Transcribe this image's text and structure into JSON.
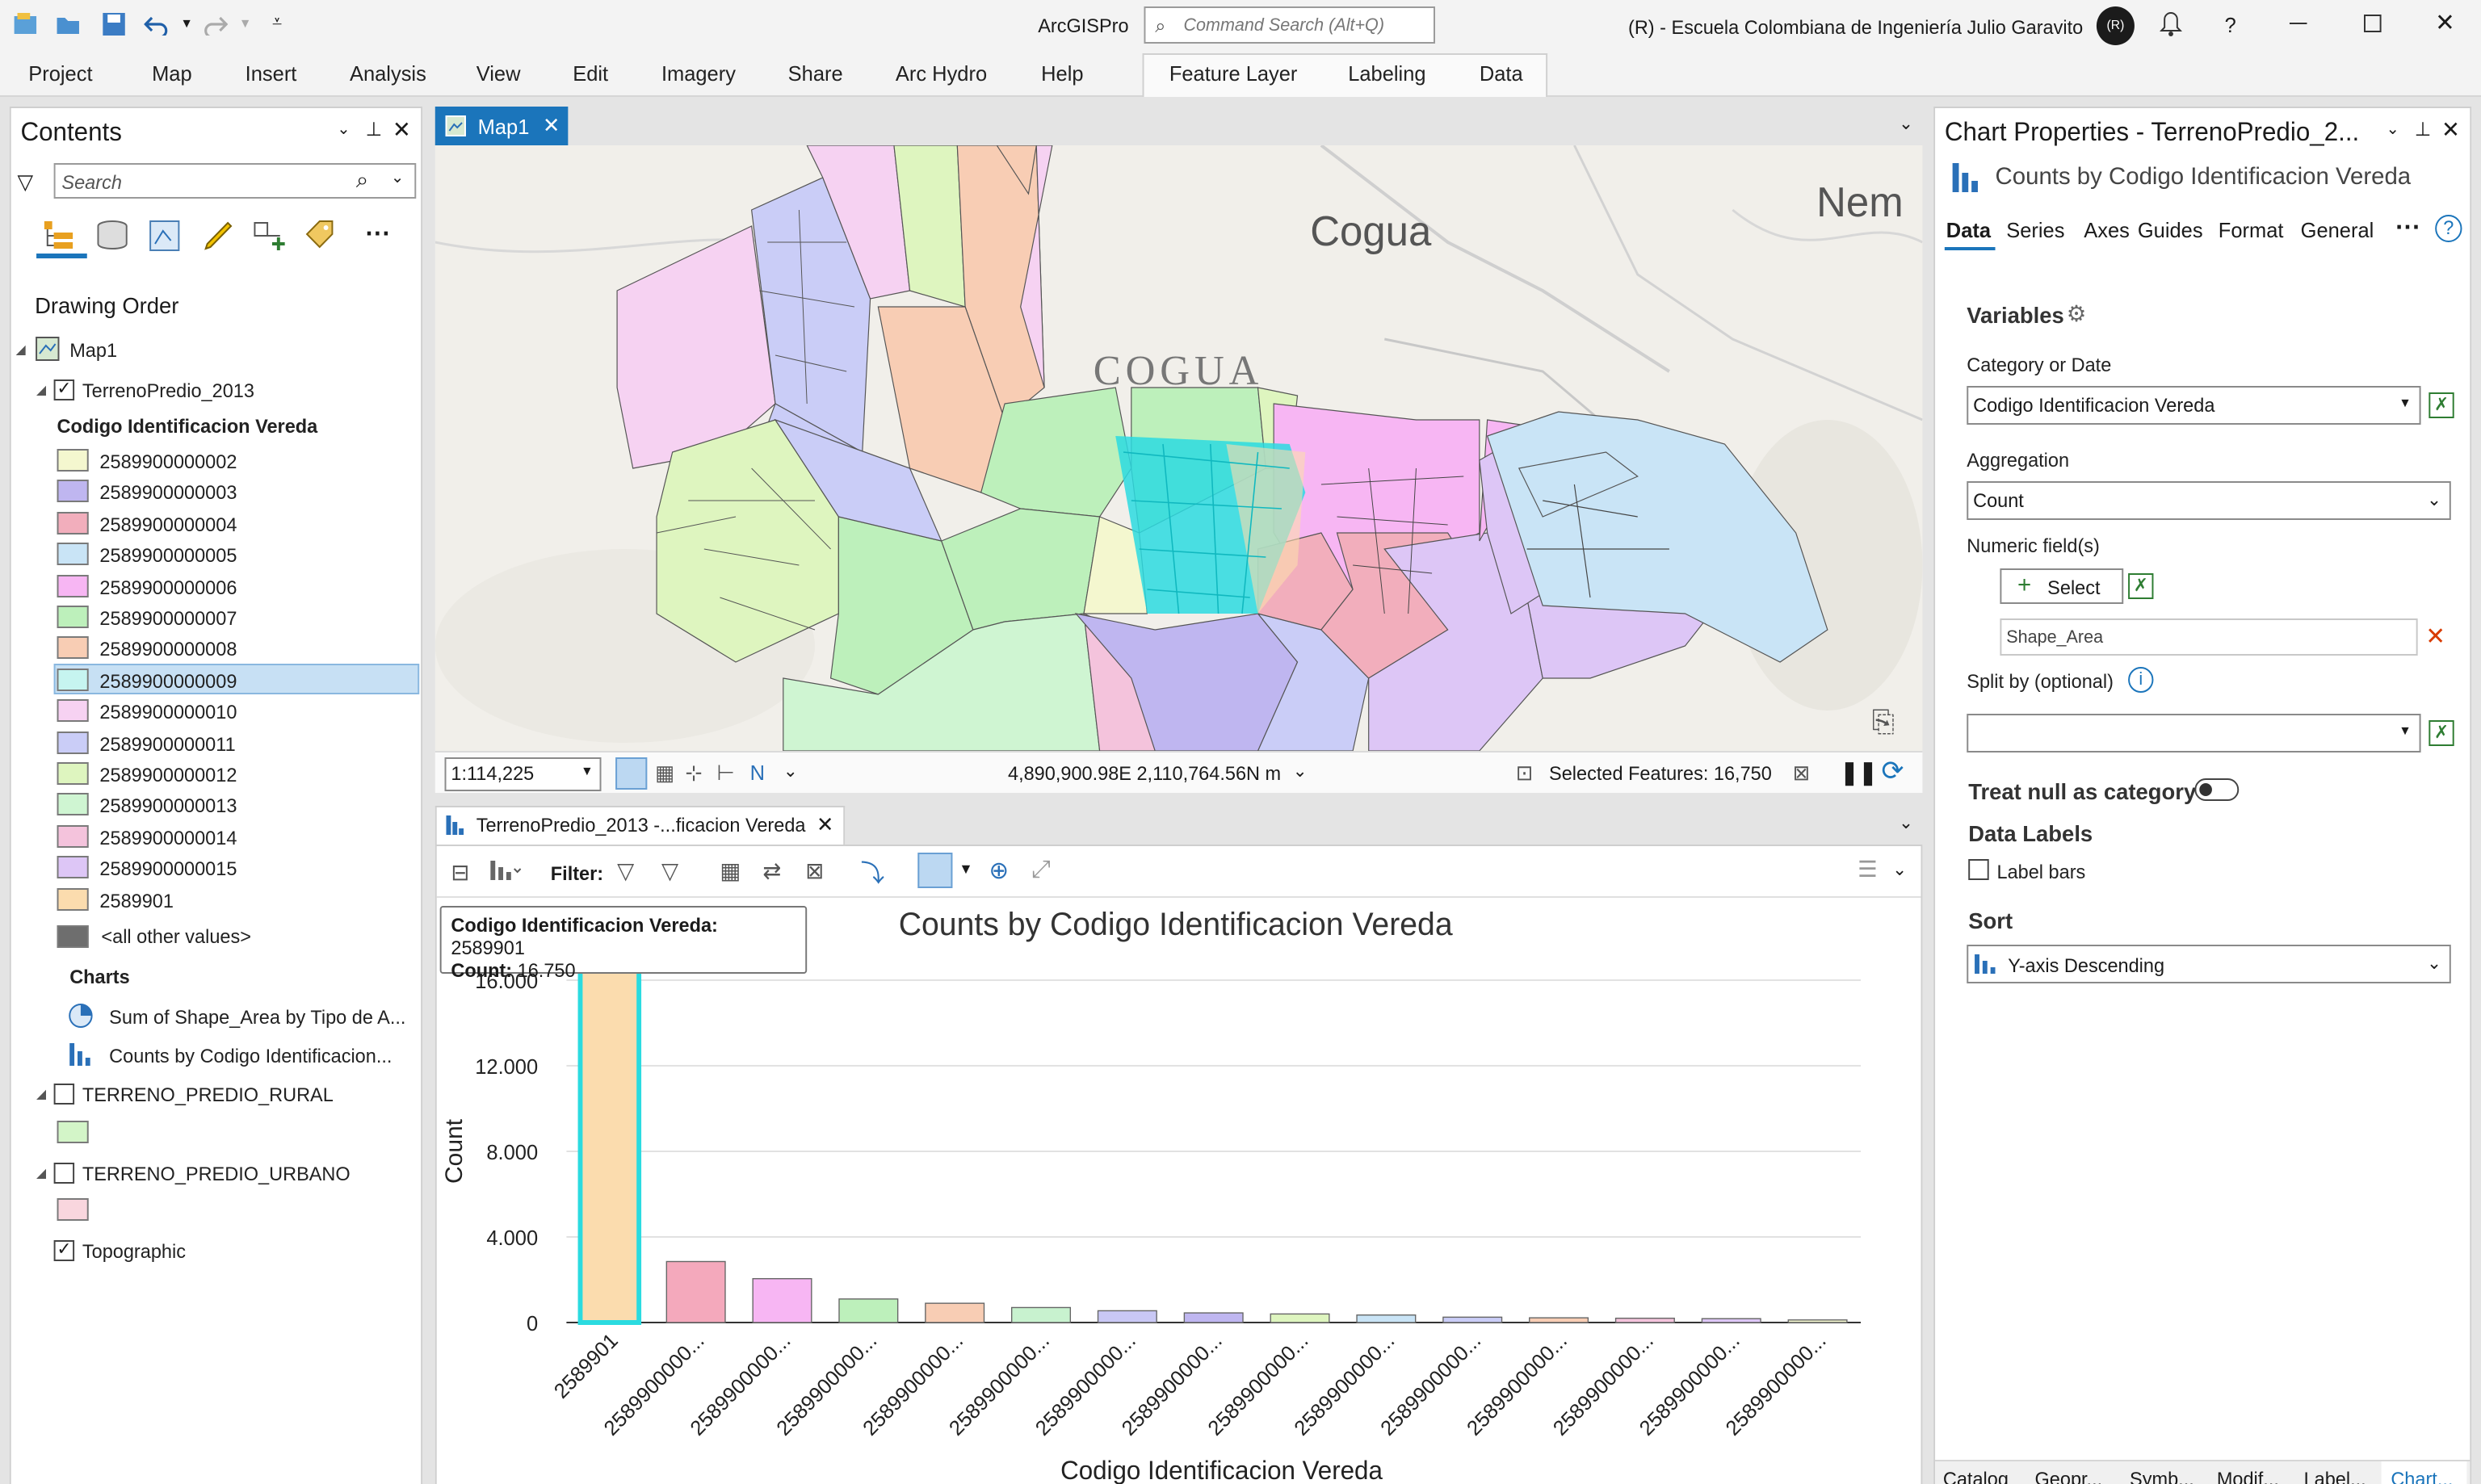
{
  "app": {
    "title": "ArcGISPro",
    "command_search_placeholder": "Command Search (Alt+Q)",
    "account": "(R) - Escuela Colombiana de Ingeniería Julio Garavito",
    "avatar": "(R)",
    "help": "?"
  },
  "ribbon": {
    "tabs": [
      "Project",
      "Map",
      "Insert",
      "Analysis",
      "View",
      "Edit",
      "Imagery",
      "Share",
      "Arc Hydro",
      "Help"
    ],
    "context_tabs": [
      "Feature Layer",
      "Labeling",
      "Data"
    ]
  },
  "contents": {
    "title": "Contents",
    "search_placeholder": "Search",
    "drawing_order": "Drawing Order",
    "map": "Map1",
    "layer": "TerrenoPredio_2013",
    "field": "Codigo Identificacion Vereda",
    "classes": [
      {
        "label": "2589900000002",
        "color": "#f4f7cf"
      },
      {
        "label": "2589900000003",
        "color": "#bfb6f0"
      },
      {
        "label": "2589900000004",
        "color": "#f2aebc"
      },
      {
        "label": "2589900000005",
        "color": "#c9e4f6"
      },
      {
        "label": "2589900000006",
        "color": "#f7b6f3"
      },
      {
        "label": "2589900000007",
        "color": "#bdf0bb"
      },
      {
        "label": "2589900000008",
        "color": "#f8cdb4"
      },
      {
        "label": "2589900000009",
        "color": "#c6f4f0"
      },
      {
        "label": "2589900000010",
        "color": "#f6d2f2"
      },
      {
        "label": "2589900000011",
        "color": "#cacdf7"
      },
      {
        "label": "2589900000012",
        "color": "#def5bf"
      },
      {
        "label": "2589900000013",
        "color": "#cff5d2"
      },
      {
        "label": "2589900000014",
        "color": "#f4c3dc"
      },
      {
        "label": "2589900000015",
        "color": "#ddc6f6"
      },
      {
        "label": "2589901",
        "color": "#fbdcae"
      }
    ],
    "other_values": "<all other values>",
    "charts_heading": "Charts",
    "charts": [
      "Sum of Shape_Area by Tipo de A...",
      "Counts by Codigo Identificacion..."
    ],
    "rural_layer": "TERRENO_PREDIO_RURAL",
    "urban_layer": "TERRENO_PREDIO_URBANO",
    "basemap": "Topographic"
  },
  "map": {
    "tab": "Map1",
    "scale": "1:114,225",
    "coords": "4,890,900.98E 2,110,764.56N m",
    "selected": "Selected Features: 16,750",
    "labels": [
      "Cogua",
      "COGUA",
      "Nem"
    ]
  },
  "chart": {
    "tab": "TerrenoPredio_2013 -...ficacion Vereda",
    "filter_label": "Filter:",
    "tooltip_key1": "Codigo Identificacion Vereda:",
    "tooltip_val1": "2589901",
    "tooltip_key2": "Count:",
    "tooltip_val2": "16.750"
  },
  "chart_data": {
    "type": "bar",
    "title": "Counts by Codigo Identificacion Vereda",
    "xlabel": "Codigo Identificacion Vereda",
    "ylabel": "Count",
    "ylim": [
      0,
      16000
    ],
    "yticks": [
      "0",
      "4.000",
      "8.000",
      "12.000",
      "16.000"
    ],
    "categories": [
      "2589901",
      "2589900000...",
      "2589900000...",
      "2589900000...",
      "2589900000...",
      "2589900000...",
      "2589900000...",
      "2589900000...",
      "2589900000...",
      "2589900000...",
      "2589900000...",
      "2589900000...",
      "2589900000...",
      "2589900000...",
      "2589900000..."
    ],
    "values": [
      16750,
      2850,
      2050,
      1100,
      900,
      700,
      550,
      450,
      400,
      350,
      250,
      220,
      200,
      180,
      120
    ],
    "colors": [
      "#fbdcae",
      "#f4a9bc",
      "#f7b6f3",
      "#bdf0bb",
      "#f8cdb4",
      "#c8f2cf",
      "#c9c8f5",
      "#bfb6f0",
      "#def5bf",
      "#c9e4f6",
      "#cacdf7",
      "#f8cdb4",
      "#f4c3dc",
      "#ddc6f6",
      "#f4f7cf"
    ],
    "grid": true
  },
  "properties": {
    "title": "Chart Properties - TerrenoPredio_2...",
    "subtitle": "Counts by Codigo Identificacion Vereda",
    "tabs": [
      "Data",
      "Series",
      "Axes",
      "Guides",
      "Format",
      "General"
    ],
    "variables": "Variables",
    "category_label": "Category or Date",
    "category_value": "Codigo Identificacion Vereda",
    "aggregation_label": "Aggregation",
    "aggregation_value": "Count",
    "numeric_label": "Numeric field(s)",
    "select_button": "Select",
    "numeric_field": "Shape_Area",
    "split_label": "Split by (optional)",
    "treat_null": "Treat null as category",
    "data_labels": "Data Labels",
    "label_bars": "Label bars",
    "sort_label": "Sort",
    "sort_value": "Y-axis Descending"
  },
  "bottom_tabs": [
    "Catalog",
    "Geopr...",
    "Symb...",
    "Modif...",
    "Label...",
    "Chart..."
  ]
}
